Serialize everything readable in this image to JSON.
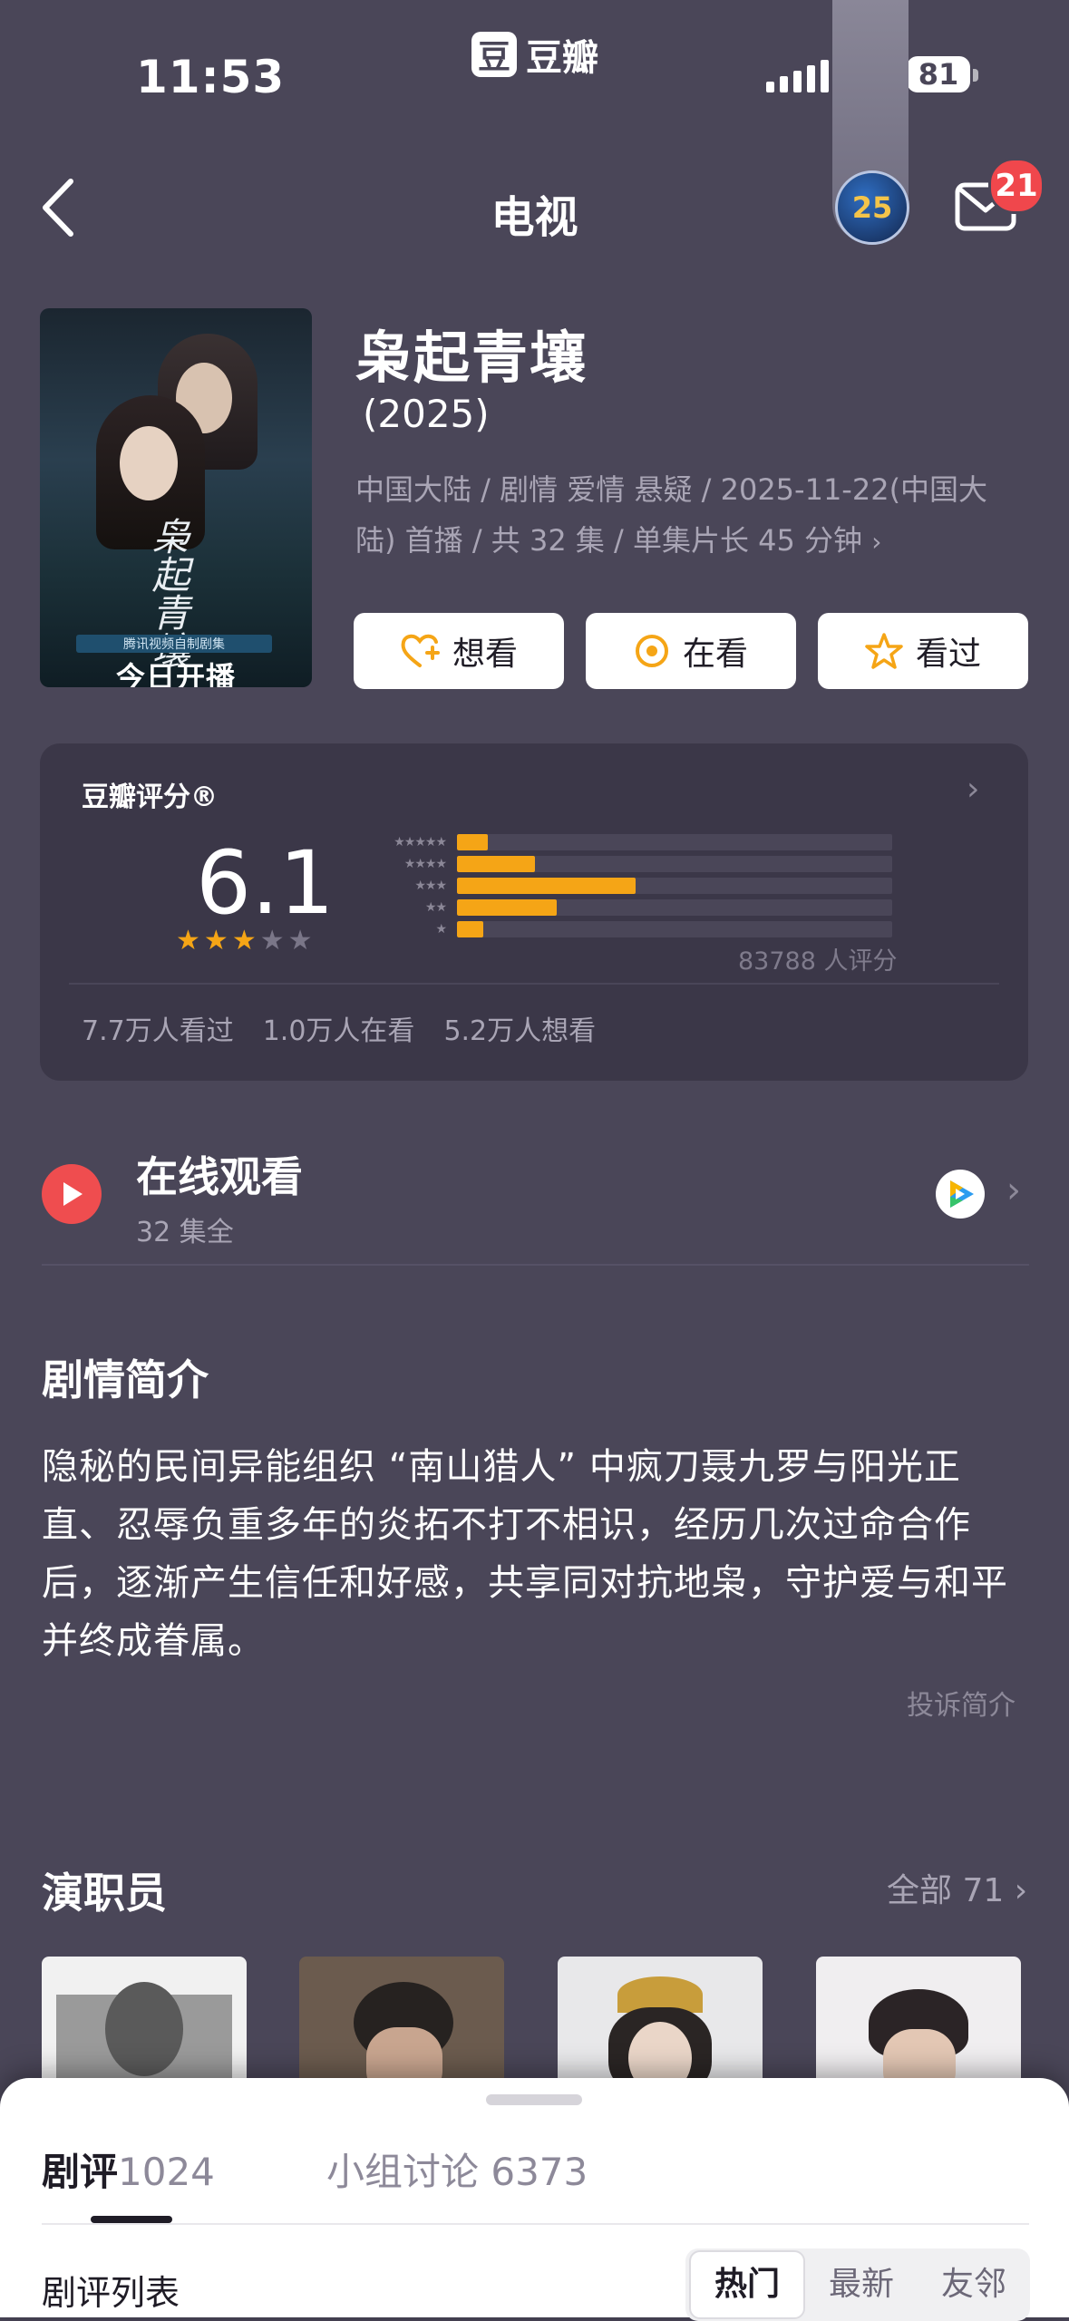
{
  "status": {
    "time": "11:53",
    "app_name": "豆瓣",
    "app_logo": "豆",
    "battery": "81",
    "badge_logo": "25"
  },
  "nav": {
    "title": "电视",
    "mail_badge": "21"
  },
  "show": {
    "title": "枭起青壤",
    "year": "(2025)",
    "meta_line1": "中国大陆 / 剧情 爱情 悬疑 / 2025-11-22(中国大",
    "meta_line2": "陆) 首播 / 共 32 集 / 单集片长 45 分钟",
    "poster_calligraphy": "枭起青壤",
    "poster_strip": "腾讯视频自制剧集",
    "poster_today": "今日开播"
  },
  "actions": {
    "want": "想看",
    "watching": "在看",
    "watched": "看过"
  },
  "rating": {
    "label": "豆瓣评分®",
    "score": "6.1",
    "stars_filled": 3,
    "stars_total": 5,
    "distribution_pct": [
      7,
      18,
      41,
      23,
      6
    ],
    "count": "83788 人评分",
    "watched": "7.7万人看过",
    "watching": "1.0万人在看",
    "want": "5.2万人想看",
    "accent": "#f5a516"
  },
  "online": {
    "title": "在线观看",
    "sub": "32 集全"
  },
  "synopsis": {
    "title": "剧情简介",
    "text": "隐秘的民间异能组织 “南山猎人” 中疯刀聂九罗与阳光正直、忍辱负重多年的炎拓不打不相识，经历几次过命合作后，逐渐产生信任和好感，共享同对抗地枭，守护爱与和平并终成眷属。",
    "report": "投诉简介"
  },
  "cast": {
    "title": "演职员",
    "all": "全部 71"
  },
  "sheet": {
    "tab_reviews": "剧评",
    "tab_reviews_count": "1024",
    "tab_groups": "小组讨论 6373",
    "list_title": "剧评列表",
    "filters": [
      "热门",
      "最新",
      "友邻"
    ]
  }
}
